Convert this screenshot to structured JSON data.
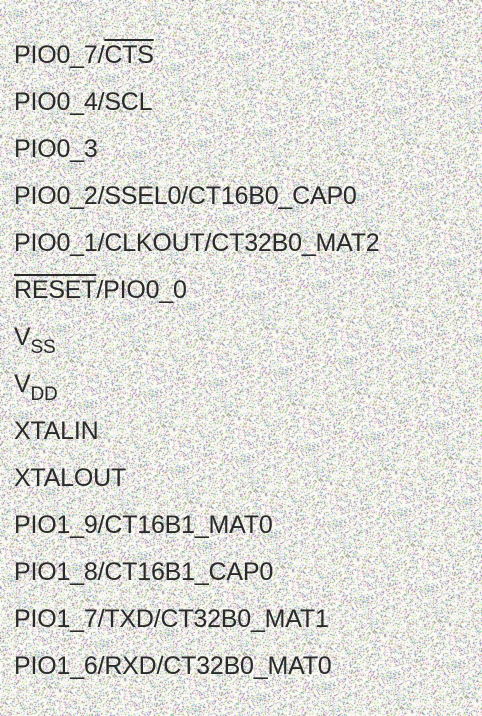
{
  "pins": [
    {
      "parts": [
        {
          "text": "PIO0_7/"
        },
        {
          "text": "CTS",
          "style": "overline"
        }
      ]
    },
    {
      "parts": [
        {
          "text": "PIO0_4/SCL"
        }
      ]
    },
    {
      "parts": [
        {
          "text": "PIO0_3"
        }
      ]
    },
    {
      "parts": [
        {
          "text": "PIO0_2/SSEL0/CT16B0_CAP0"
        }
      ]
    },
    {
      "parts": [
        {
          "text": "PIO0_1/CLKOUT/CT32B0_MAT2"
        }
      ]
    },
    {
      "parts": [
        {
          "text": "RESET",
          "style": "overline"
        },
        {
          "text": "/PIO0_0"
        }
      ]
    },
    {
      "parts": [
        {
          "text": "V"
        },
        {
          "text": "SS",
          "style": "subscript"
        }
      ]
    },
    {
      "parts": [
        {
          "text": "V"
        },
        {
          "text": "DD",
          "style": "subscript"
        }
      ]
    },
    {
      "parts": [
        {
          "text": "XTALIN"
        }
      ]
    },
    {
      "parts": [
        {
          "text": "XTALOUT"
        }
      ]
    },
    {
      "parts": [
        {
          "text": "PIO1_9/CT16B1_MAT0"
        }
      ]
    },
    {
      "parts": [
        {
          "text": "PIO1_8/CT16B1_CAP0"
        }
      ]
    },
    {
      "parts": [
        {
          "text": "PIO1_7/TXD/CT32B0_MAT1"
        }
      ]
    },
    {
      "parts": [
        {
          "text": "PIO1_6/RXD/CT32B0_MAT0"
        }
      ]
    }
  ],
  "colors": {
    "text": "#2a2a2a",
    "background": "#fbfaf4"
  }
}
